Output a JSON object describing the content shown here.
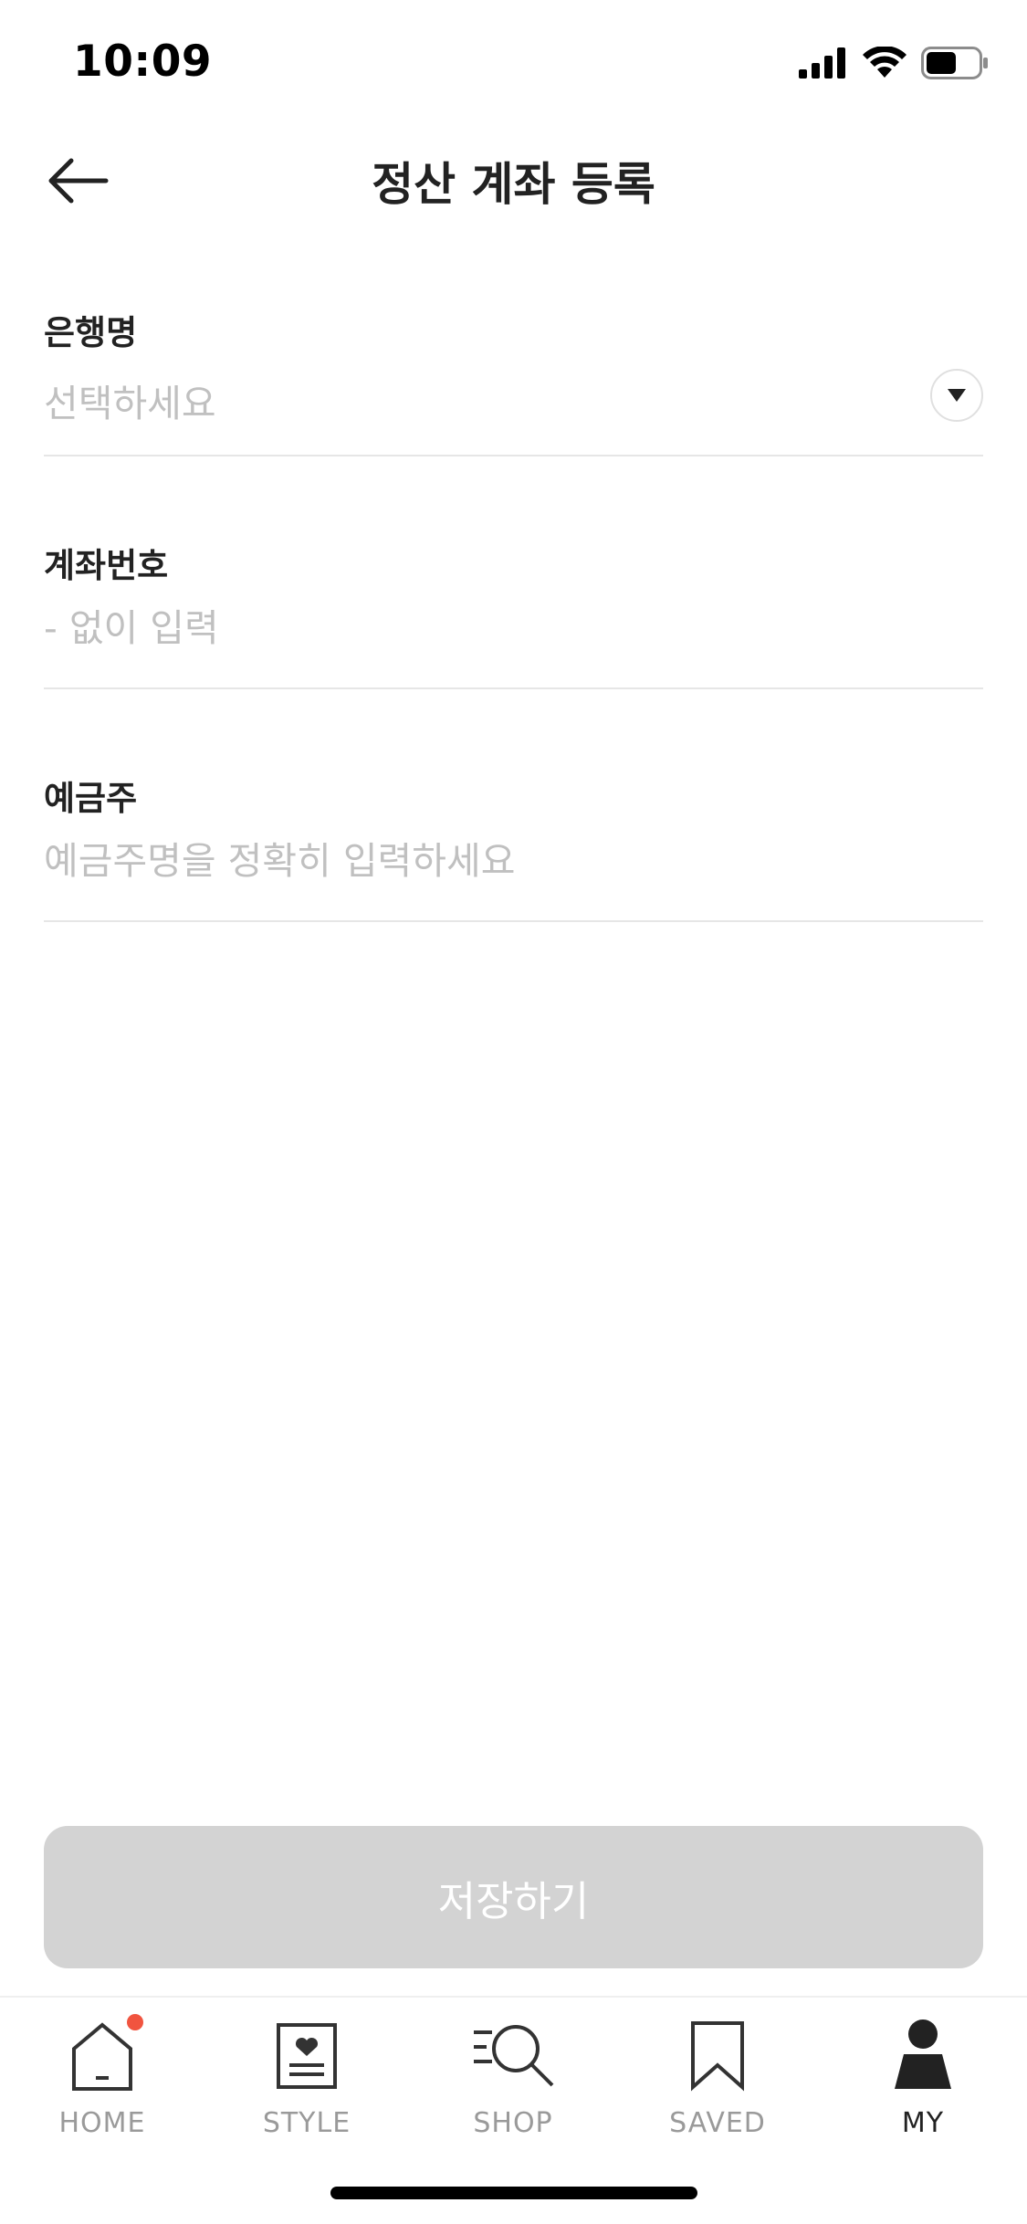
{
  "status_bar": {
    "time": "10:09"
  },
  "header": {
    "title": "정산 계좌 등록"
  },
  "form": {
    "bank": {
      "label": "은행명",
      "placeholder": "선택하세요"
    },
    "account_number": {
      "label": "계좌번호",
      "placeholder": "- 없이 입력"
    },
    "account_holder": {
      "label": "예금주",
      "placeholder": "예금주명을 정확히 입력하세요"
    }
  },
  "save_button": {
    "label": "저장하기",
    "state": "disabled"
  },
  "tab_bar": {
    "active_tab": "MY",
    "tabs": [
      {
        "label": "HOME",
        "icon": "home-icon",
        "has_badge": true
      },
      {
        "label": "STYLE",
        "icon": "style-icon",
        "has_badge": false
      },
      {
        "label": "SHOP",
        "icon": "shop-search-icon",
        "has_badge": false
      },
      {
        "label": "SAVED",
        "icon": "bookmark-icon",
        "has_badge": false
      },
      {
        "label": "MY",
        "icon": "person-icon",
        "has_badge": false
      }
    ]
  },
  "colors": {
    "accent_badge": "#f1543f",
    "disabled_button": "#d3d3d3",
    "placeholder_text": "#c0c0c0",
    "divider": "#e6e6e6"
  }
}
